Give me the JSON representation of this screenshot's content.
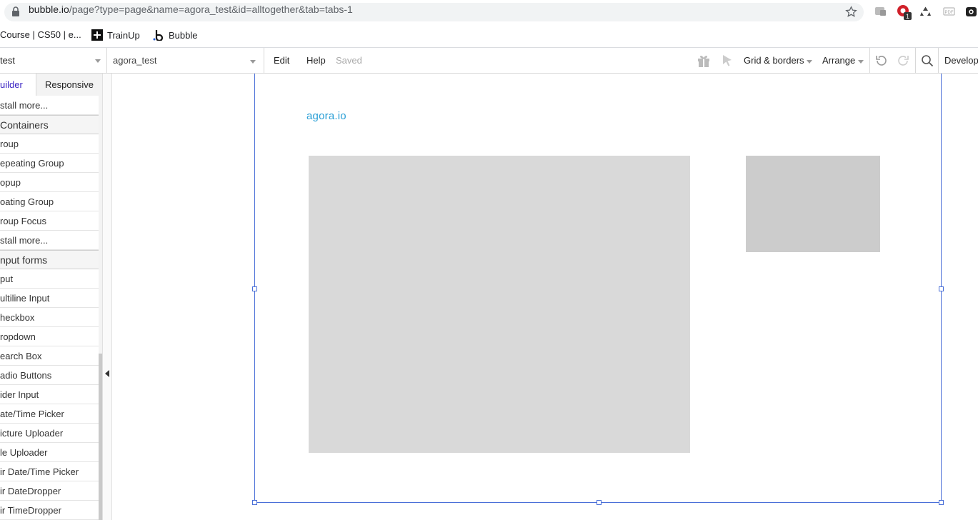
{
  "browser": {
    "url_host": "bubble.io",
    "url_path": "/page?type=page&name=agora_test&id=alltogether&tab=tabs-1",
    "bookmarks": [
      {
        "label": "Course | CS50 | e..."
      },
      {
        "label": "TrainUp"
      },
      {
        "label": "Bubble"
      }
    ],
    "extension_badge": "1"
  },
  "editor": {
    "app_select": "test",
    "page_select": "agora_test",
    "edit_label": "Edit",
    "help_label": "Help",
    "saved_label": "Saved",
    "grid_label": "Grid & borders",
    "arrange_label": "Arrange",
    "develop_label": "Develop"
  },
  "panel": {
    "tabs": [
      {
        "label": "uilder",
        "color": "#3b25c4"
      },
      {
        "label": "Responsive"
      }
    ],
    "items": [
      {
        "type": "row",
        "label": "stall more..."
      },
      {
        "type": "head",
        "label": "Containers"
      },
      {
        "type": "row",
        "label": "roup"
      },
      {
        "type": "row",
        "label": "epeating Group"
      },
      {
        "type": "row",
        "label": "opup"
      },
      {
        "type": "row",
        "label": "oating Group"
      },
      {
        "type": "row",
        "label": "roup Focus"
      },
      {
        "type": "row",
        "label": "stall more..."
      },
      {
        "type": "head",
        "label": "nput forms"
      },
      {
        "type": "row",
        "label": "put"
      },
      {
        "type": "row",
        "label": "ultiline Input"
      },
      {
        "type": "row",
        "label": "heckbox"
      },
      {
        "type": "row",
        "label": "ropdown"
      },
      {
        "type": "row",
        "label": "earch Box"
      },
      {
        "type": "row",
        "label": "adio Buttons"
      },
      {
        "type": "row",
        "label": "ider Input"
      },
      {
        "type": "row",
        "label": "ate/Time Picker"
      },
      {
        "type": "row",
        "label": "icture Uploader"
      },
      {
        "type": "row",
        "label": "le Uploader"
      },
      {
        "type": "row",
        "label": "ir Date/Time Picker"
      },
      {
        "type": "row",
        "label": "ir DateDropper"
      },
      {
        "type": "row",
        "label": "ir TimeDropper"
      }
    ]
  },
  "canvas": {
    "logo_text": "agora.io",
    "logo_color": "#2a9fd6",
    "selection_color": "#4a6fd8"
  }
}
